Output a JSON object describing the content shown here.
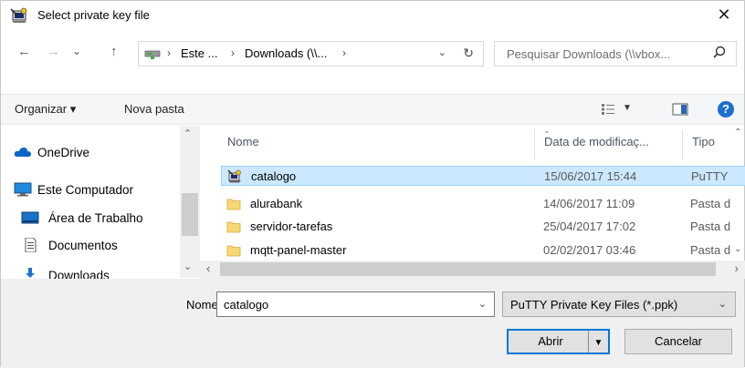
{
  "window": {
    "title": "Select private key file",
    "close_glyph": "✕"
  },
  "nav": {
    "back": "←",
    "forward": "→",
    "recent": "⌄",
    "up": "↑",
    "breadcrumbs": [
      "Este ...",
      "Downloads (\\\\...",
      ""
    ],
    "separator": "›",
    "address_dropdown": "⌄",
    "refresh": "↻",
    "search_placeholder": "Pesquisar Downloads (\\\\vbox..."
  },
  "toolbar": {
    "organize": "Organizar ▾",
    "new_folder": "Nova pasta",
    "view_dropdown": "▼",
    "help": "?"
  },
  "navpane": {
    "items": [
      {
        "label": "OneDrive",
        "icon": "cloud-icon"
      },
      {
        "label": "Este Computador",
        "icon": "computer-icon"
      },
      {
        "label": "Área de Trabalho",
        "icon": "desktop-icon"
      },
      {
        "label": "Documentos",
        "icon": "document-icon"
      },
      {
        "label": "Downloads",
        "icon": "download-icon"
      }
    ]
  },
  "filelist": {
    "columns": {
      "name": "Nome",
      "date": "Data de modificaç...",
      "type": "Tipo"
    },
    "rows": [
      {
        "name": "catalogo",
        "date": "15/06/2017 15:44",
        "type": "PuTTY",
        "icon": "putty-key-icon",
        "selected": true
      },
      {
        "name": "alurabank",
        "date": "14/06/2017 11:09",
        "type": "Pasta d",
        "icon": "folder-icon"
      },
      {
        "name": "servidor-tarefas",
        "date": "25/04/2017 17:02",
        "type": "Pasta d",
        "icon": "folder-icon"
      },
      {
        "name": "mqtt-panel-master",
        "date": "02/02/2017 03:46",
        "type": "Pasta d",
        "icon": "folder-icon"
      }
    ]
  },
  "bottom": {
    "name_label": "Nome:",
    "name_value": "catalogo",
    "filter": "PuTTY Private Key Files (*.ppk)",
    "open": "Abrir",
    "cancel": "Cancelar"
  },
  "colors": {
    "selection": "#cce8ff",
    "accent": "#0078d7",
    "folder": "#f8d775"
  }
}
